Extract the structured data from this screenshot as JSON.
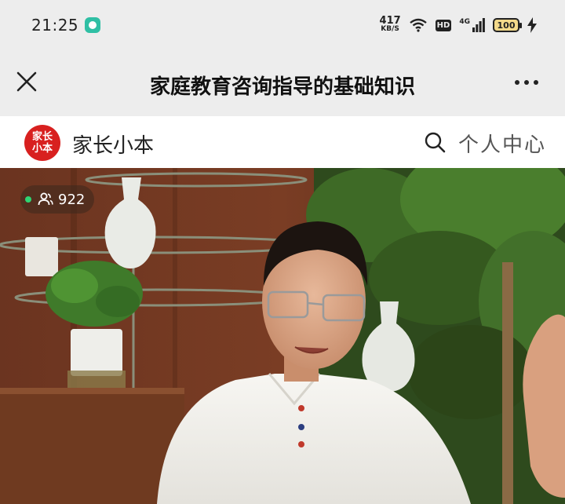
{
  "status_bar": {
    "time": "21:25",
    "net_speed": "417",
    "net_unit": "KB/S",
    "hd_label": "HD",
    "network_label": "4G",
    "battery": "100"
  },
  "title_bar": {
    "title": "家庭教育咨询指导的基础知识"
  },
  "app_header": {
    "logo_text_line1": "家长",
    "logo_text_line2": "小本",
    "brand_name": "家长小本",
    "profile_label": "个人中心"
  },
  "video": {
    "viewer_count": "922",
    "live_indicator_color": "#2ed573"
  },
  "icons": [
    "close-icon",
    "more-icon",
    "search-icon",
    "viewers-icon",
    "wifi-icon",
    "signal-icon",
    "battery-icon",
    "charging-icon"
  ],
  "colors": {
    "brand_red": "#d8201f",
    "title_bar_bg": "#ededed",
    "header_bg": "#ffffff"
  }
}
